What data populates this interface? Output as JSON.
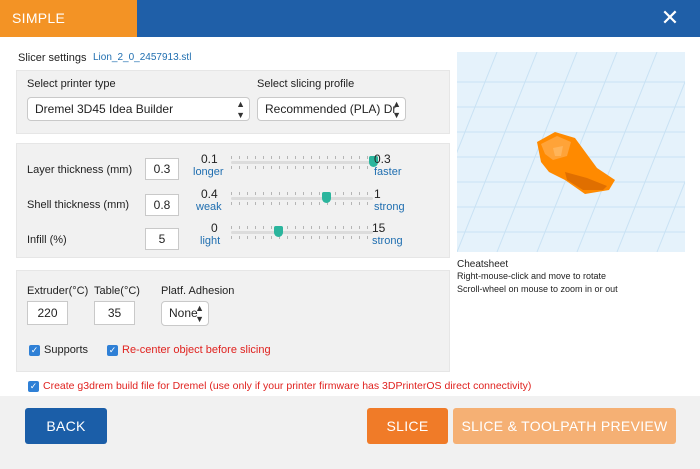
{
  "window": {
    "tab_title": "SIMPLE",
    "close_glyph": "✕"
  },
  "slicer": {
    "label": "Slicer settings",
    "filename": "Lion_2_0_2457913.stl"
  },
  "printer": {
    "label": "Select printer type",
    "value": "Dremel 3D45 Idea Builder"
  },
  "profile": {
    "label": "Select slicing profile",
    "value": "Recommended (PLA) Dr"
  },
  "layer": {
    "label": "Layer thickness (mm)",
    "value": "0.3",
    "min": "0.1",
    "min_desc": "longer",
    "max": "0.3",
    "max_desc": "faster",
    "level": 1.0
  },
  "shell": {
    "label": "Shell thickness (mm)",
    "value": "0.8",
    "min": "0.4",
    "min_desc": "weak",
    "max": "1",
    "max_desc": "strong",
    "level": 0.67
  },
  "infill": {
    "label": "Infill (%)",
    "value": "5",
    "min": "0",
    "min_desc": "light",
    "max": "15",
    "max_desc": "strong",
    "level": 0.33
  },
  "extruder": {
    "label": "Extruder(°C)",
    "value": "220"
  },
  "table": {
    "label": "Table(°C)",
    "value": "35"
  },
  "adhesion": {
    "label": "Platf. Adhesion",
    "value": "None"
  },
  "options": {
    "supports": "Supports",
    "recenter": "Re-center object before slicing",
    "g3drem": "Create g3drem build file for Dremel (use only if your printer firmware has 3DPrinterOS direct connectivity)"
  },
  "cheatsheet": {
    "title": "Cheatsheet",
    "line1": "Right-mouse-click and move to rotate",
    "line2": "Scroll-wheel on mouse to zoom in or out"
  },
  "buttons": {
    "back": "BACK",
    "slice": "SLICE",
    "preview": "SLICE & TOOLPATH PREVIEW"
  },
  "colors": {
    "brand_blue": "#1f5fa8",
    "accent_orange": "#f39325",
    "slider_teal": "#2bb59d",
    "warning_red": "#e0221f",
    "model_orange": "#ff8a00"
  }
}
